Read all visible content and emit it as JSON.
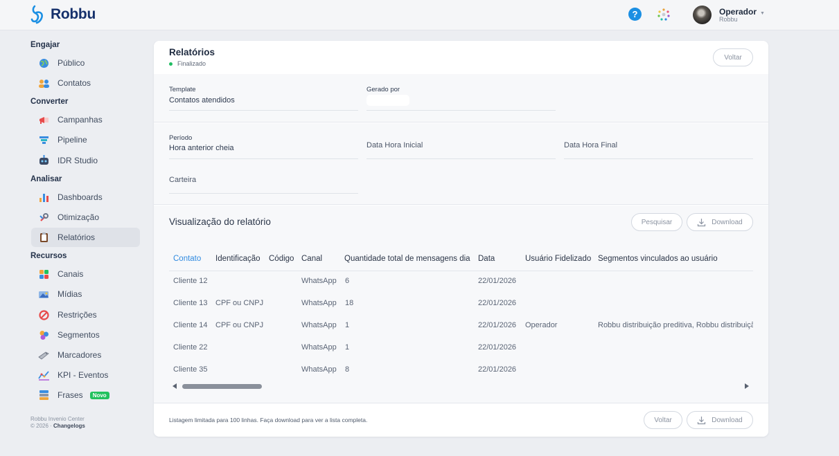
{
  "app": {
    "brand": "Robbu",
    "accent": "#2f8ae0",
    "brand_color": "#15306b"
  },
  "header": {
    "help_icon": "question-icon",
    "apps_icon": "apps-dots-icon",
    "user": {
      "name": "Operador",
      "org": "Robbu"
    }
  },
  "sidebar": {
    "sections": [
      {
        "title": "Engajar",
        "items": [
          {
            "label": "Público",
            "icon": "globe-icon"
          },
          {
            "label": "Contatos",
            "icon": "people-icon"
          }
        ]
      },
      {
        "title": "Converter",
        "items": [
          {
            "label": "Campanhas",
            "icon": "megaphone-icon"
          },
          {
            "label": "Pipeline",
            "icon": "funnel-icon"
          },
          {
            "label": "IDR Studio",
            "icon": "robot-icon"
          }
        ]
      },
      {
        "title": "Analisar",
        "items": [
          {
            "label": "Dashboards",
            "icon": "bar-chart-icon"
          },
          {
            "label": "Otimização",
            "icon": "wrench-icon"
          },
          {
            "label": "Relatórios",
            "icon": "clipboard-icon",
            "active": true
          }
        ]
      },
      {
        "title": "Recursos",
        "items": [
          {
            "label": "Canais",
            "icon": "channels-icon"
          },
          {
            "label": "Mídias",
            "icon": "media-icon"
          },
          {
            "label": "Restrições",
            "icon": "block-icon"
          },
          {
            "label": "Segmentos",
            "icon": "segments-icon"
          },
          {
            "label": "Marcadores",
            "icon": "tag-icon"
          },
          {
            "label": "KPI - Eventos",
            "icon": "kpi-icon"
          },
          {
            "label": "Frases",
            "icon": "books-icon",
            "badge": "Novo"
          }
        ]
      }
    ],
    "footer": {
      "line1": "Robbu Invenio Center",
      "line2_prefix": "© 2026 · ",
      "line2_link": "Changelogs"
    }
  },
  "report": {
    "title": "Relatórios",
    "status": "Finalizado",
    "back_label": "Voltar",
    "fields": {
      "template_label": "Template",
      "template_value": "Contatos atendidos",
      "generated_by_label": "Gerado por",
      "period_label": "Período",
      "period_value": "Hora anterior cheia",
      "start_placeholder": "Data Hora Inicial",
      "end_placeholder": "Data Hora Final",
      "wallet_placeholder": "Carteira"
    },
    "preview": {
      "title": "Visualização do relatório",
      "search_label": "Pesquisar",
      "download_label": "Download"
    },
    "table": {
      "columns": [
        "Contato",
        "Identificação",
        "Código",
        "Canal",
        "Quantidade total de mensagens dia",
        "Data",
        "Usuário Fidelizado",
        "Segmentos vinculados ao usuário"
      ],
      "rows": [
        [
          "Cliente 12",
          "",
          "",
          "WhatsApp",
          "6",
          "22/01/2026",
          "",
          ""
        ],
        [
          "Cliente 13",
          "CPF ou CNPJ",
          "",
          "WhatsApp",
          "18",
          "22/01/2026",
          "",
          ""
        ],
        [
          "Cliente 14",
          "CPF ou CNPJ",
          "",
          "WhatsApp",
          "1",
          "22/01/2026",
          "Operador",
          "Robbu distribuição preditiva, Robbu distribuição"
        ],
        [
          "Cliente 22",
          "",
          "",
          "WhatsApp",
          "1",
          "22/01/2026",
          "",
          ""
        ],
        [
          "Cliente 35",
          "",
          "",
          "WhatsApp",
          "8",
          "22/01/2026",
          "",
          ""
        ]
      ]
    },
    "footer": {
      "note": "Listagem limitada para 100 linhas. Faça download para ver a lista completa.",
      "back_label": "Voltar",
      "download_label": "Download"
    }
  }
}
